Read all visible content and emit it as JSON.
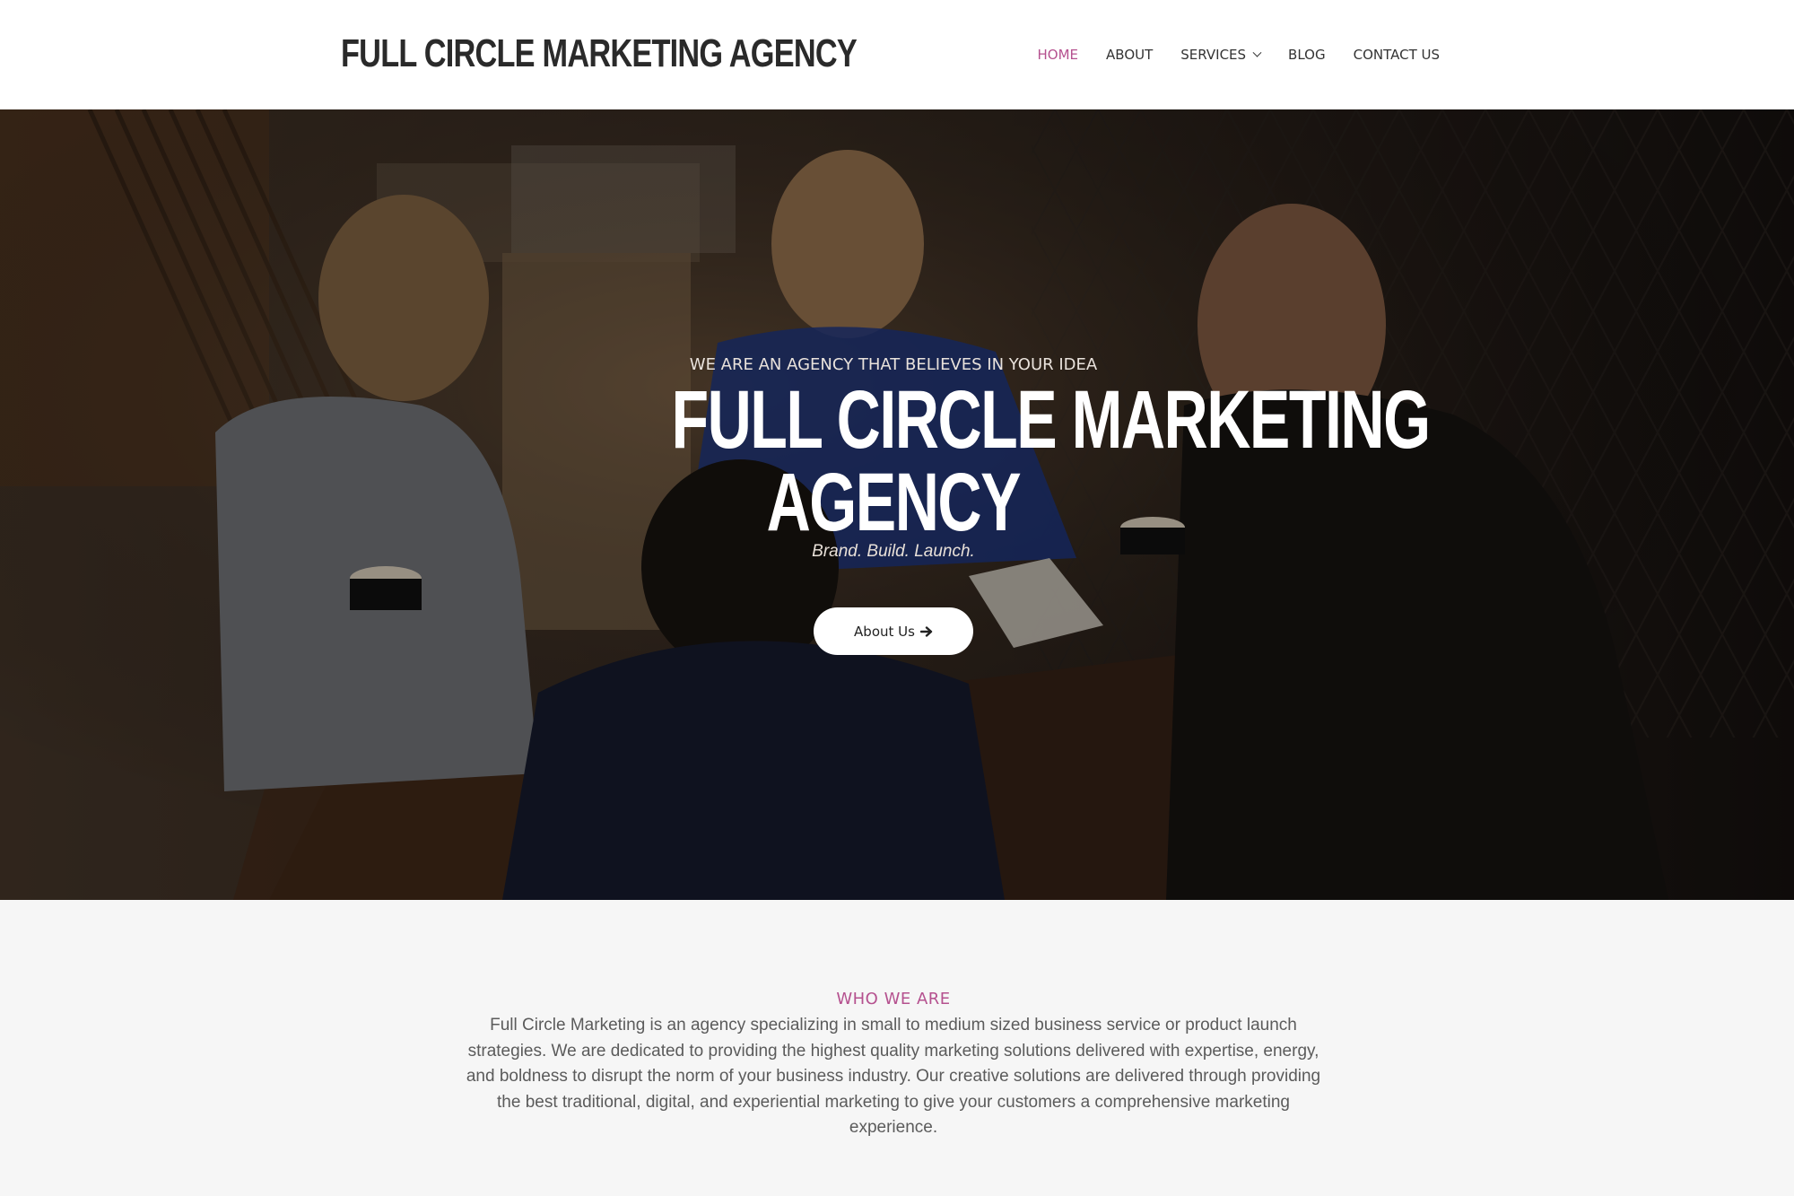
{
  "header": {
    "brand": "FULL CIRCLE MARKETING AGENCY",
    "nav": [
      {
        "label": "HOME",
        "active": true
      },
      {
        "label": "ABOUT",
        "active": false
      },
      {
        "label": "SERVICES",
        "active": false,
        "has_dropdown": true
      },
      {
        "label": "BLOG",
        "active": false
      },
      {
        "label": "CONTACT US",
        "active": false
      }
    ]
  },
  "hero": {
    "kicker": "WE ARE AN AGENCY THAT BELIEVES IN YOUR IDEA",
    "title_line1": "FULL CIRCLE MARKETING",
    "title_line2": "AGENCY",
    "tagline": "Brand. Build. Launch.",
    "button_label": "About Us",
    "button_icon": "arrow-right-icon",
    "background": "photo of people meeting at a cafe table"
  },
  "about": {
    "heading": "WHO WE ARE",
    "body": "Full Circle Marketing is an agency specializing in small to medium sized business service or product launch strategies. We are dedicated to providing the highest quality marketing solutions delivered with expertise, energy, and boldness to disrupt the norm of your business industry. Our creative solutions are delivered through providing the best traditional, digital, and experiential marketing to give your customers a comprehensive marketing experience."
  },
  "colors": {
    "accent": "#b5518f",
    "header_bg": "#ffffff",
    "section_bg": "#f6f6f6",
    "nav_text": "#333333"
  }
}
